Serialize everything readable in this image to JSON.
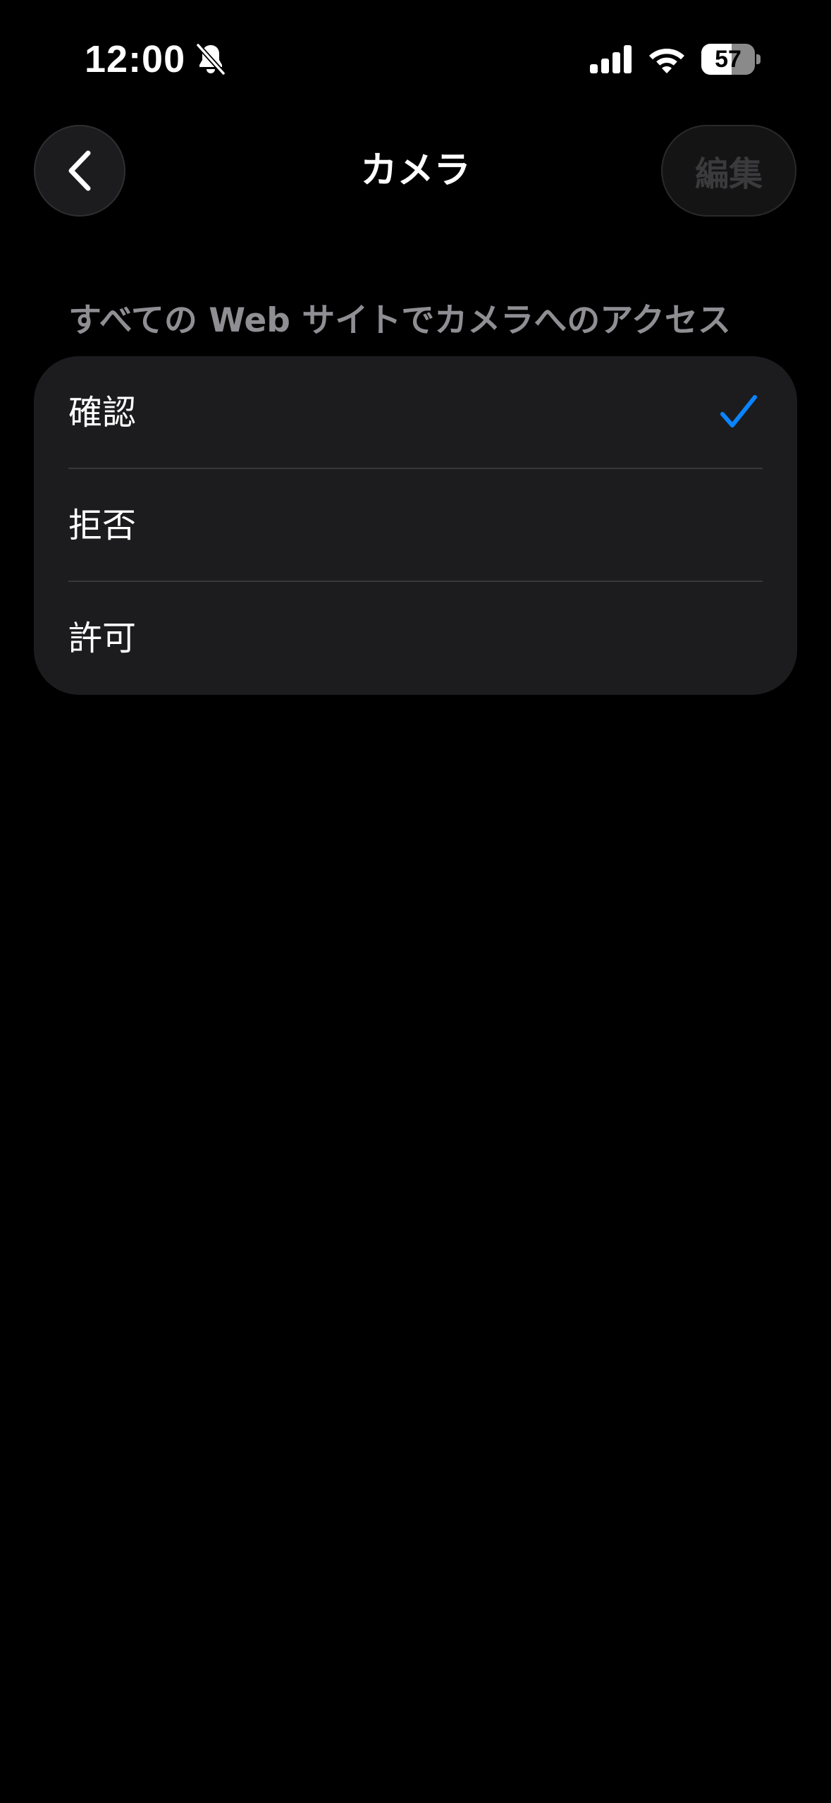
{
  "status_bar": {
    "time": "12:00",
    "battery_level": "57",
    "battery_fraction": 0.57,
    "icons": [
      "bell-slash-icon",
      "cellular-signal-icon",
      "wifi-icon",
      "battery-icon"
    ]
  },
  "nav": {
    "back_icon": "chevron-left-icon",
    "title": "カメラ",
    "edit_label": "編集"
  },
  "section": {
    "header": "すべての Web サイトでカメラへのアクセス",
    "options": [
      {
        "label": "確認",
        "selected": true
      },
      {
        "label": "拒否",
        "selected": false
      },
      {
        "label": "許可",
        "selected": false
      }
    ]
  },
  "colors": {
    "background": "#000000",
    "cell_background": "#1c1c1e",
    "accent": "#0a84ff",
    "secondary_text": "#8e8e93",
    "disabled_text": "#3a3a3c"
  }
}
